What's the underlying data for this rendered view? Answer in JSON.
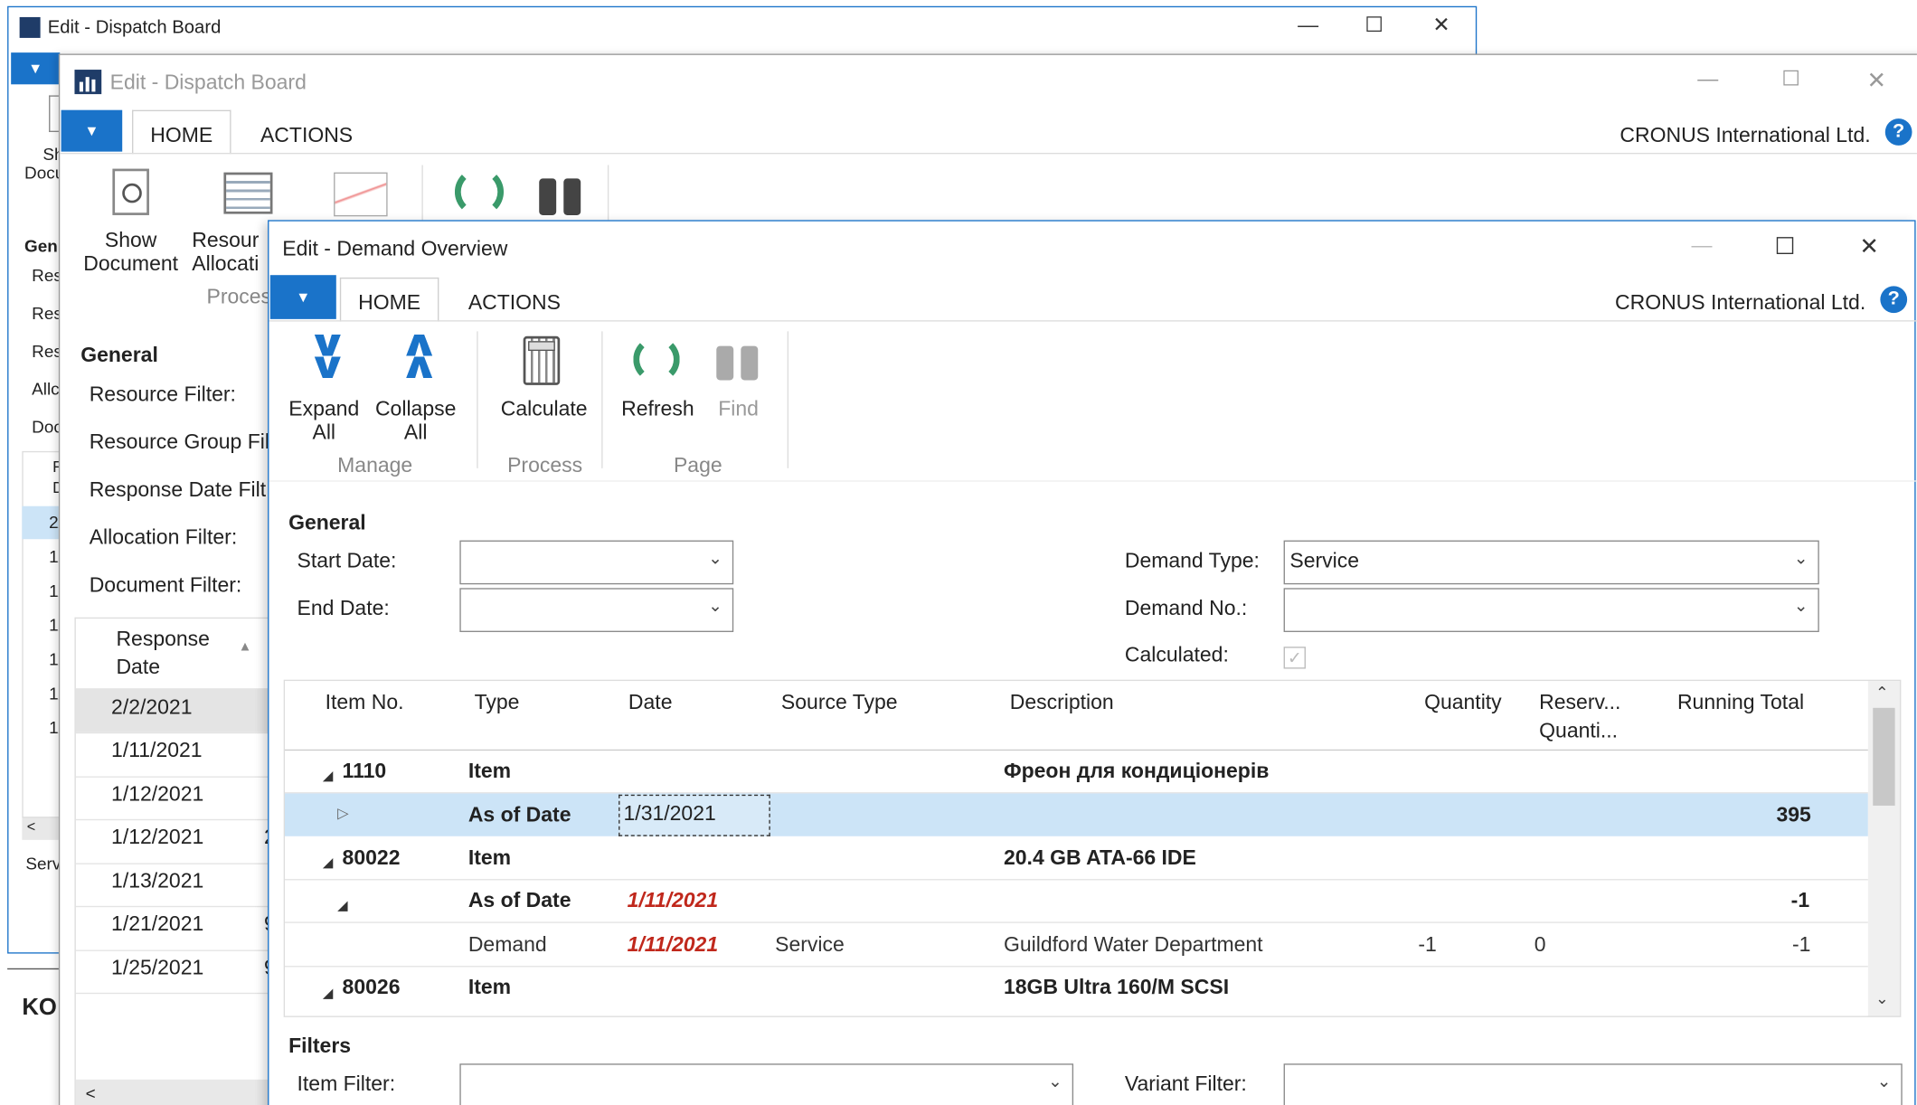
{
  "bg_window": {
    "title": "Edit - Dispatch Board",
    "side_items": [
      "Sh",
      "Docu",
      "Gen",
      "Res",
      "Res",
      "Res",
      "Allc",
      "Doc"
    ],
    "list_dates": [
      "F",
      "D",
      "2/",
      "1/",
      "1/",
      "1/",
      "1/",
      "1/",
      "1/"
    ],
    "footer_label": "Serv",
    "bottom_text": "KO"
  },
  "dispatch": {
    "title": "Edit - Dispatch Board",
    "tabs": [
      "HOME",
      "ACTIONS"
    ],
    "company": "CRONUS International Ltd.",
    "help": "?",
    "ribbon": {
      "show_document": "Show Document",
      "resource_allocation": "Resour Allocati",
      "process_group": "Proces"
    },
    "general_title": "General",
    "filters": [
      "Resource Filter:",
      "Resource Group Fil",
      "Response Date Filt",
      "Allocation Filter:",
      "Document Filter:"
    ],
    "list_header": "Response Date",
    "list_rows": [
      "2/2/2021",
      "1/11/2021",
      "1/12/2021",
      "1/12/2021",
      "1/13/2021",
      "1/21/2021",
      "1/25/2021"
    ],
    "list_side": [
      "",
      "",
      "",
      "2",
      "",
      "9",
      "9"
    ]
  },
  "demand": {
    "title": "Edit - Demand Overview",
    "tabs": [
      "HOME",
      "ACTIONS"
    ],
    "company": "CRONUS International Ltd.",
    "help": "?",
    "ribbon": {
      "expand_all": "Expand All",
      "collapse_all": "Collapse All",
      "calculate": "Calculate",
      "refresh": "Refresh",
      "find": "Find",
      "groups": {
        "manage": "Manage",
        "process": "Process",
        "page": "Page"
      }
    },
    "general_title": "General",
    "start_date_label": "Start Date:",
    "start_date_value": "",
    "end_date_label": "End Date:",
    "end_date_value": "",
    "demand_type_label": "Demand Type:",
    "demand_type_value": "Service",
    "demand_no_label": "Demand No.:",
    "demand_no_value": "",
    "calculated_label": "Calculated:",
    "grid": {
      "columns": [
        "Item No.",
        "Type",
        "Date",
        "Source Type",
        "Description",
        "Quantity",
        "Reserv... Quanti...",
        "Running Total"
      ],
      "rows": [
        {
          "item_no": "1110",
          "type": "Item",
          "date": "",
          "source_type": "",
          "description": "Фреон для кондиціонерів",
          "quantity": "",
          "reserved": "",
          "running_total": ""
        },
        {
          "item_no": "",
          "type": "As of Date",
          "date": "1/31/2021",
          "source_type": "",
          "description": "",
          "quantity": "",
          "reserved": "",
          "running_total": "395"
        },
        {
          "item_no": "80022",
          "type": "Item",
          "date": "",
          "source_type": "",
          "description": "20.4 GB ATA-66 IDE",
          "quantity": "",
          "reserved": "",
          "running_total": ""
        },
        {
          "item_no": "",
          "type": "As of Date",
          "date": "1/11/2021",
          "source_type": "",
          "description": "",
          "quantity": "",
          "reserved": "",
          "running_total": "-1"
        },
        {
          "item_no": "",
          "type": "Demand",
          "date": "1/11/2021",
          "source_type": "Service",
          "description": "Guildford Water Department",
          "quantity": "-1",
          "reserved": "0",
          "running_total": "-1"
        },
        {
          "item_no": "80026",
          "type": "Item",
          "date": "",
          "source_type": "",
          "description": "18GB Ultra 160/M SCSI",
          "quantity": "",
          "reserved": "",
          "running_total": ""
        }
      ]
    },
    "filters_title": "Filters",
    "item_filter_label": "Item Filter:",
    "item_filter_value": "",
    "variant_filter_label": "Variant Filter:",
    "variant_filter_value": ""
  },
  "colors": {
    "accent": "#1a73c9",
    "selected_row": "#cce4f7",
    "red_date": "#c0281c",
    "refresh_green": "#3a9a6a"
  }
}
